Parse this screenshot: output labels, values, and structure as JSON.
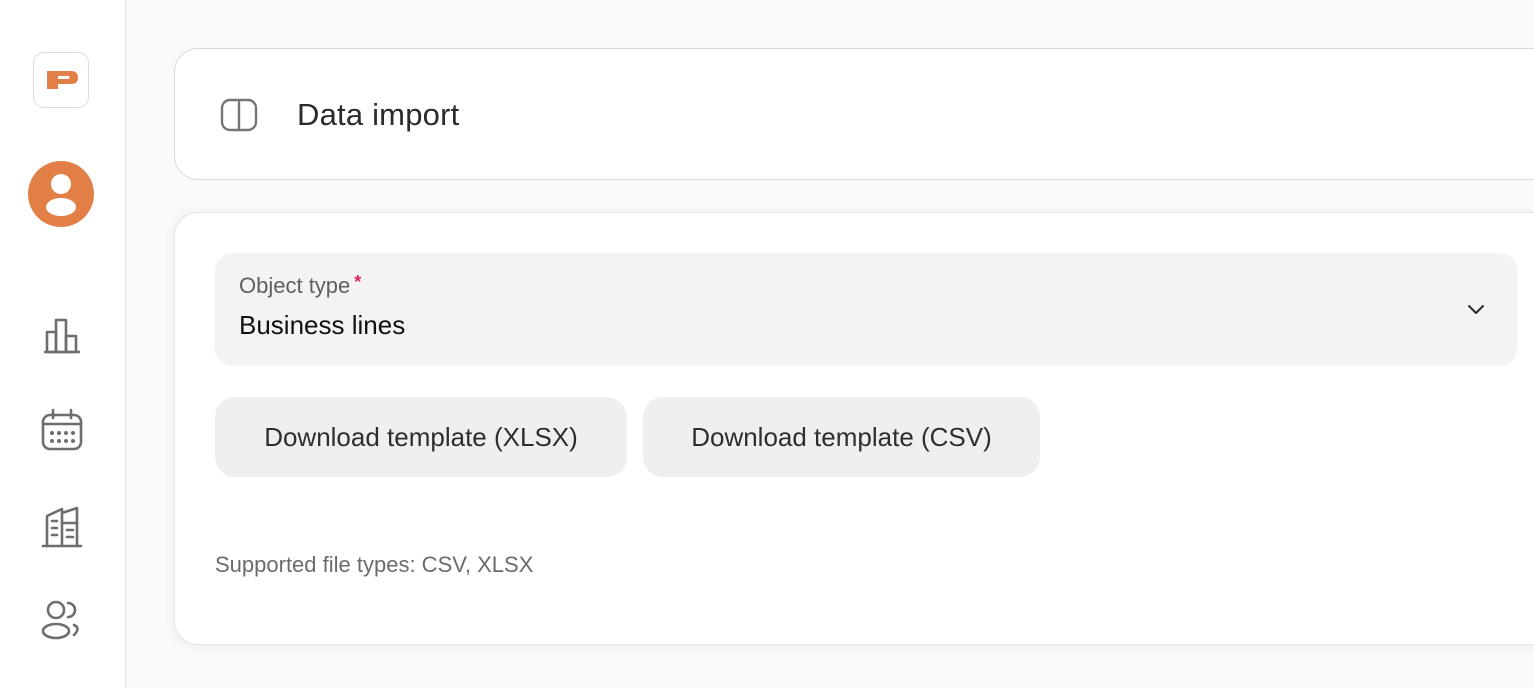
{
  "sidebar": {
    "logo_letter": "P",
    "brand_color": "#e27f46",
    "nav": [
      {
        "id": "analytics",
        "icon": "bar-chart-icon"
      },
      {
        "id": "calendar",
        "icon": "calendar-icon"
      },
      {
        "id": "buildings",
        "icon": "building-icon"
      },
      {
        "id": "users",
        "icon": "users-icon"
      }
    ]
  },
  "header": {
    "title": "Data import",
    "toggle_icon": "sidebar-panel-icon"
  },
  "form": {
    "object_type": {
      "label": "Object type",
      "required_mark": "*",
      "value": "Business lines",
      "icon": "chevron-down-icon"
    },
    "buttons": {
      "download_xlsx": "Download template (XLSX)",
      "download_csv": "Download template (CSV)"
    },
    "supported_types": "Supported file types: CSV, XLSX"
  },
  "colors": {
    "accent": "#e27f46",
    "required": "#e0245e",
    "icon_gray": "#6e6e6e"
  }
}
